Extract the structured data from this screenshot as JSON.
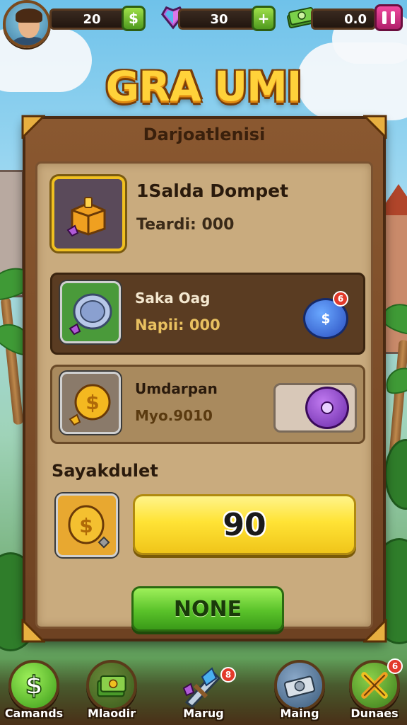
{
  "hud": {
    "coins": "20",
    "coins_button": "$",
    "gems": "30",
    "gems_button": "+",
    "cash": "0.0",
    "icons": [
      "player-avatar",
      "gem-heart-icon",
      "cash-stack-icon",
      "pause-icon"
    ]
  },
  "title": "GRA UMI",
  "panel": {
    "header": "Darjoatlenisi",
    "rows": [
      {
        "title": "1Salda Dompet",
        "value": "Teardi: 000",
        "icon": "treasure-chest-icon"
      },
      {
        "title": "Saka Oag",
        "value": "Napii: 000",
        "icon": "silver-coin-icon",
        "action_icon": "blue-dollar-coin-icon",
        "badge": "6"
      },
      {
        "title": "Umdarpan",
        "value": "Myo.9010",
        "icon": "gold-coin-icon",
        "action_icon": "purple-coin-icon"
      }
    ],
    "section_label": "Sayakdulet",
    "balance_value": "90",
    "confirm_button": "NONE"
  },
  "bottom_nav": [
    {
      "label": "Camands",
      "icon": "dollar-coin-icon"
    },
    {
      "label": "Mlaodir",
      "icon": "cash-bundle-icon"
    },
    {
      "label": "Marug",
      "icon": "sword-gem-icon",
      "badge": "8"
    },
    {
      "label": "Maing",
      "icon": "silver-cash-icon"
    },
    {
      "label": "Dunaes",
      "icon": "crossed-tools-icon",
      "badge": "6"
    }
  ],
  "colors": {
    "panel_wood": "#8a5830",
    "panel_paper": "#c9ab7e",
    "accent_yellow": "#ffe335",
    "accent_green": "#5ac22a",
    "title_gold": "#ffd23a"
  }
}
